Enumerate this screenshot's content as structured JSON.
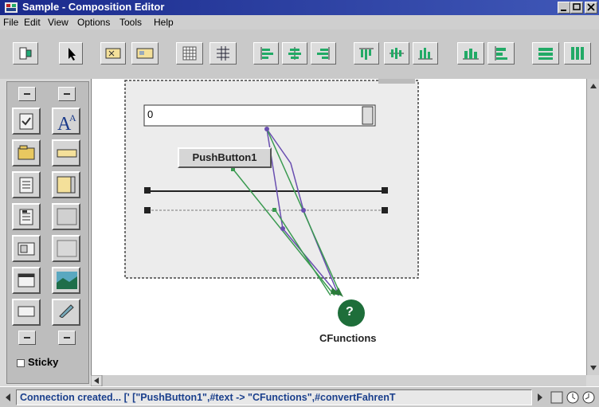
{
  "window": {
    "title": "Sample - Composition Editor"
  },
  "menu": [
    "File",
    "Edit",
    "View",
    "Options",
    "Tools",
    "Help"
  ],
  "palette": {
    "sticky_label": "Sticky"
  },
  "canvas": {
    "textfield_value": "0",
    "pushbutton_label": "PushButton1",
    "cfunctions_glyph": "?",
    "cfunctions_label": "CFunctions"
  },
  "status": {
    "message": "Connection created... [' [\"PushButton1\",#text -> \"CFunctions\",#convertFahrenT"
  },
  "colors": {
    "title_start": "#1a2a8c",
    "title_end": "#4058b8",
    "connection_purple": "#6a4fb0",
    "connection_green": "#3a9a50",
    "part_green": "#1e6e3a"
  }
}
